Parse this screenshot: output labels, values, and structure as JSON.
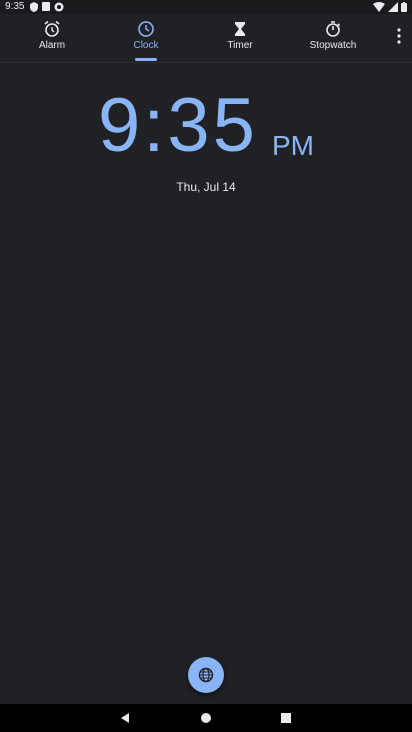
{
  "status_bar": {
    "time": "9:35"
  },
  "tabs": [
    {
      "label": "Alarm",
      "icon": "alarm-icon",
      "active": false
    },
    {
      "label": "Clock",
      "icon": "clock-icon",
      "active": true
    },
    {
      "label": "Timer",
      "icon": "hourglass-icon",
      "active": false
    },
    {
      "label": "Stopwatch",
      "icon": "stopwatch-icon",
      "active": false
    }
  ],
  "clock": {
    "time": "9:35",
    "ampm": "PM",
    "date": "Thu, Jul 14"
  },
  "fab": {
    "icon": "globe-icon"
  },
  "colors": {
    "accent": "#8ab4f8",
    "background": "#202124",
    "text": "#e8eaed"
  }
}
